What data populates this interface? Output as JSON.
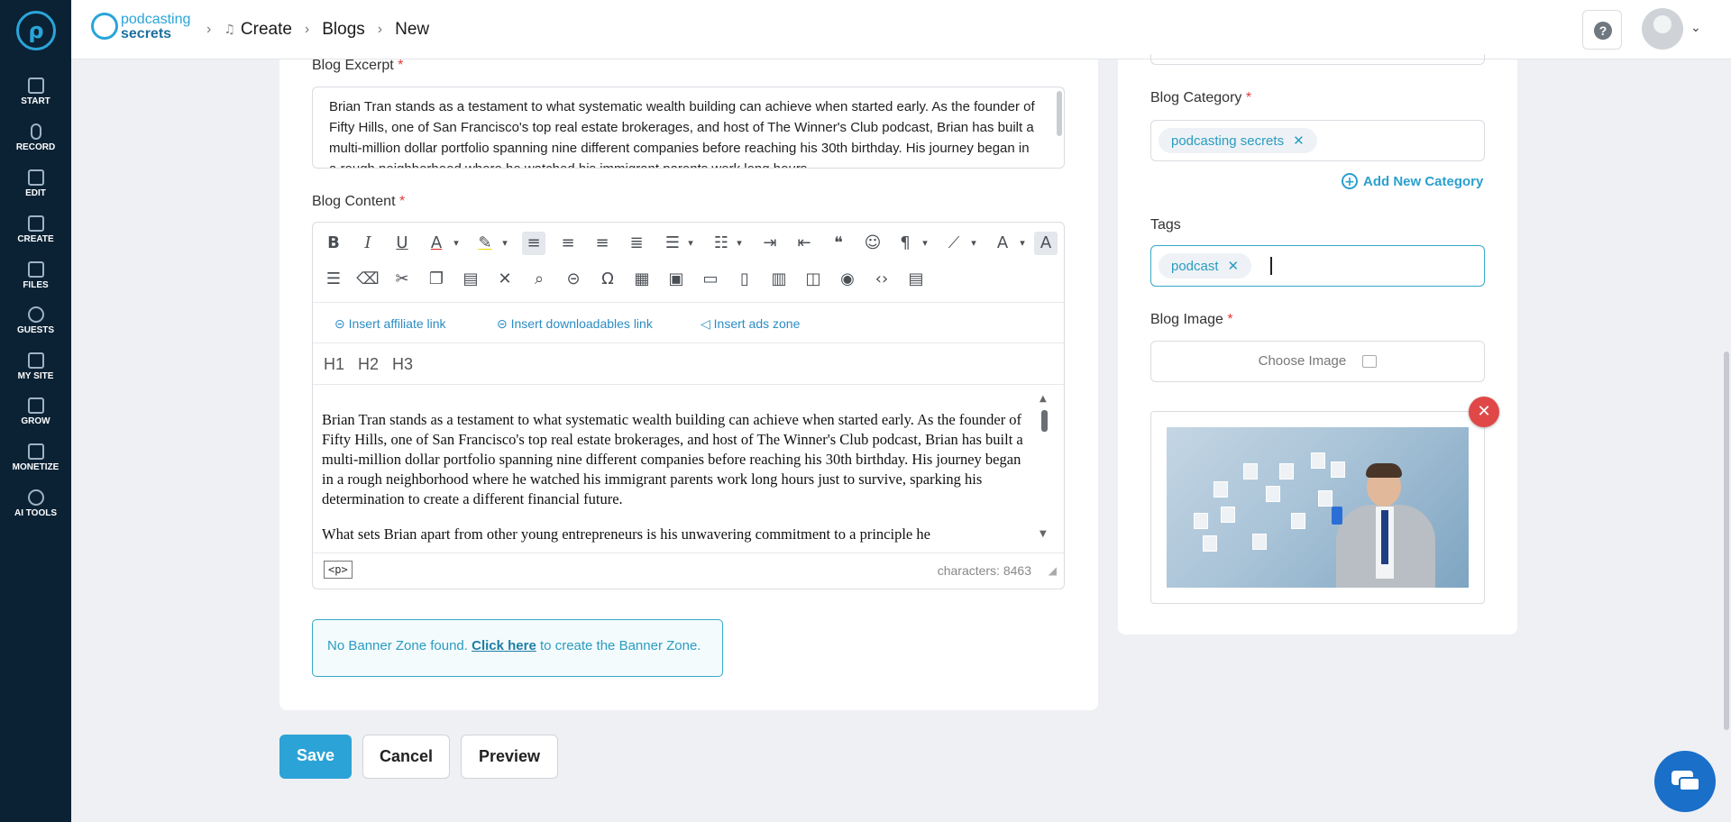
{
  "nav": {
    "items": [
      "START",
      "RECORD",
      "EDIT",
      "CREATE",
      "FILES",
      "GUESTS",
      "MY SITE",
      "GROW",
      "MONETIZE",
      "AI TOOLS"
    ]
  },
  "brand": {
    "line1": "podcasting",
    "line2": "secrets"
  },
  "breadcrumb": {
    "items": [
      "Create",
      "Blogs",
      "New"
    ]
  },
  "help_icon": "?",
  "excerpt": {
    "label": "Blog Excerpt",
    "required": "*",
    "text": "Brian Tran stands as a testament to what systematic wealth building can achieve when started early. As the founder of Fifty Hills, one of San Francisco's top real estate brokerages, and host of The Winner's Club podcast, Brian has built a multi-million dollar portfolio spanning nine different companies before reaching his 30th birthday. His journey began in a rough neighborhood where he watched his immigrant parents work long hours"
  },
  "content": {
    "label": "Blog Content",
    "required": "*",
    "link_tools": [
      "Insert affiliate link",
      "Insert downloadables link",
      "Insert ads zone"
    ],
    "headings": [
      "H1",
      "H2",
      "H3"
    ],
    "paragraphs": [
      "Brian Tran stands as a testament to what systematic wealth building can achieve when started early. As the founder of Fifty Hills, one of San Francisco's top real estate brokerages, and host of The Winner's Club podcast, Brian has built a multi-million dollar portfolio spanning nine different companies before reaching his 30th birthday. His journey began in a rough neighborhood where he watched his immigrant parents work long hours just to survive, sparking his determination to create a different financial future.",
      "What sets Brian apart from other young entrepreneurs is his unwavering commitment to a principle he"
    ],
    "status_tag": "<p>",
    "characters": "characters: 8463"
  },
  "banner": {
    "prefix": "No Banner Zone found.",
    "link": "Click here",
    "suffix": "to create the Banner Zone."
  },
  "actions": {
    "save": "Save",
    "cancel": "Cancel",
    "preview": "Preview"
  },
  "category": {
    "label": "Blog Category",
    "required": "*",
    "chip": "podcasting secrets",
    "add_label": "Add New Category"
  },
  "tags": {
    "label": "Tags",
    "chip": "podcast"
  },
  "image": {
    "label": "Blog Image",
    "required": "*",
    "choose": "Choose Image"
  },
  "colors": {
    "accent": "#2ca3d6",
    "sidebar": "#0b2235",
    "danger": "#e04848",
    "chat": "#1a6fc9"
  }
}
